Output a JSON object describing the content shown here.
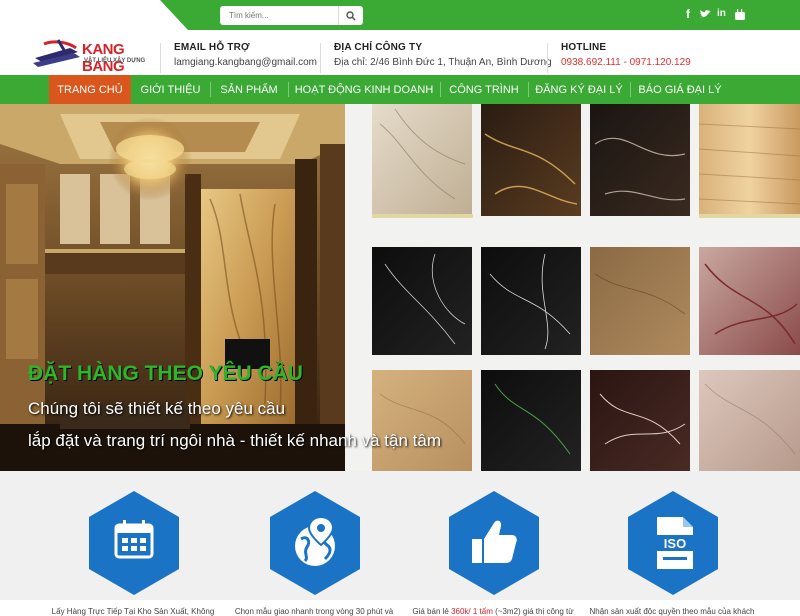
{
  "topbar": {
    "search_placeholder": "Tìm kiếm...",
    "social": [
      "facebook-icon",
      "twitter-icon",
      "linkedin-icon",
      "youtube-icon"
    ]
  },
  "logo": {
    "title": "KANG BANG",
    "subtitle": "VẬT LIỆU XÂY DỰNG"
  },
  "header": {
    "email_label": "EMAIL HỖ TRỢ",
    "email_value": "lamgiang.kangbang@gmail.com",
    "address_label": "ĐỊA CHỈ CÔNG TY",
    "address_value": "Địa chỉ: 2/46  Bình Đức 1, Thuận An, Bình Dương",
    "hotline_label": "HOTLINE",
    "hotline_value": "0938.692.111 - 0971.120.129"
  },
  "nav": {
    "items": [
      "TRANG CHỦ",
      "GIỚI THIỆU",
      "SẢN PHẨM",
      "HOẠT ĐỘNG KINH DOANH",
      "CÔNG TRÌNH",
      "ĐĂNG KÝ ĐẠI LÝ",
      "BÁO GIÁ ĐẠI LÝ"
    ],
    "active": "TRANG CHỦ"
  },
  "hero": {
    "headline": "ĐẶT HÀNG THEO YÊU CẦU",
    "line1": "Chúng tôi sẽ thiết kế theo yêu cầu",
    "line2": "lắp đặt và trang trí ngôi nhà - thiết kế nhanh và tận tâm"
  },
  "features": [
    {
      "icon": "calendar-icon",
      "text": "Lấy Hàng Trực Tiếp Tại Kho Sản Xuất, Không"
    },
    {
      "icon": "globe-location-icon",
      "text": "Chọn mẫu giao nhanh trong vòng 30 phút và"
    },
    {
      "icon": "thumbs-up-icon",
      "text_pre": "Giá bán lẻ ",
      "text_red": "360k/ 1 tấm",
      "text_post": " (~3m2) giá thị công từ"
    },
    {
      "icon": "iso-file-icon",
      "text": "Nhận sản xuất độc quyền theo mẫu của khách"
    }
  ],
  "colors": {
    "green": "#3aaa35",
    "orange": "#d9571d",
    "red": "#d4242a",
    "blue": "#1a73c4"
  }
}
